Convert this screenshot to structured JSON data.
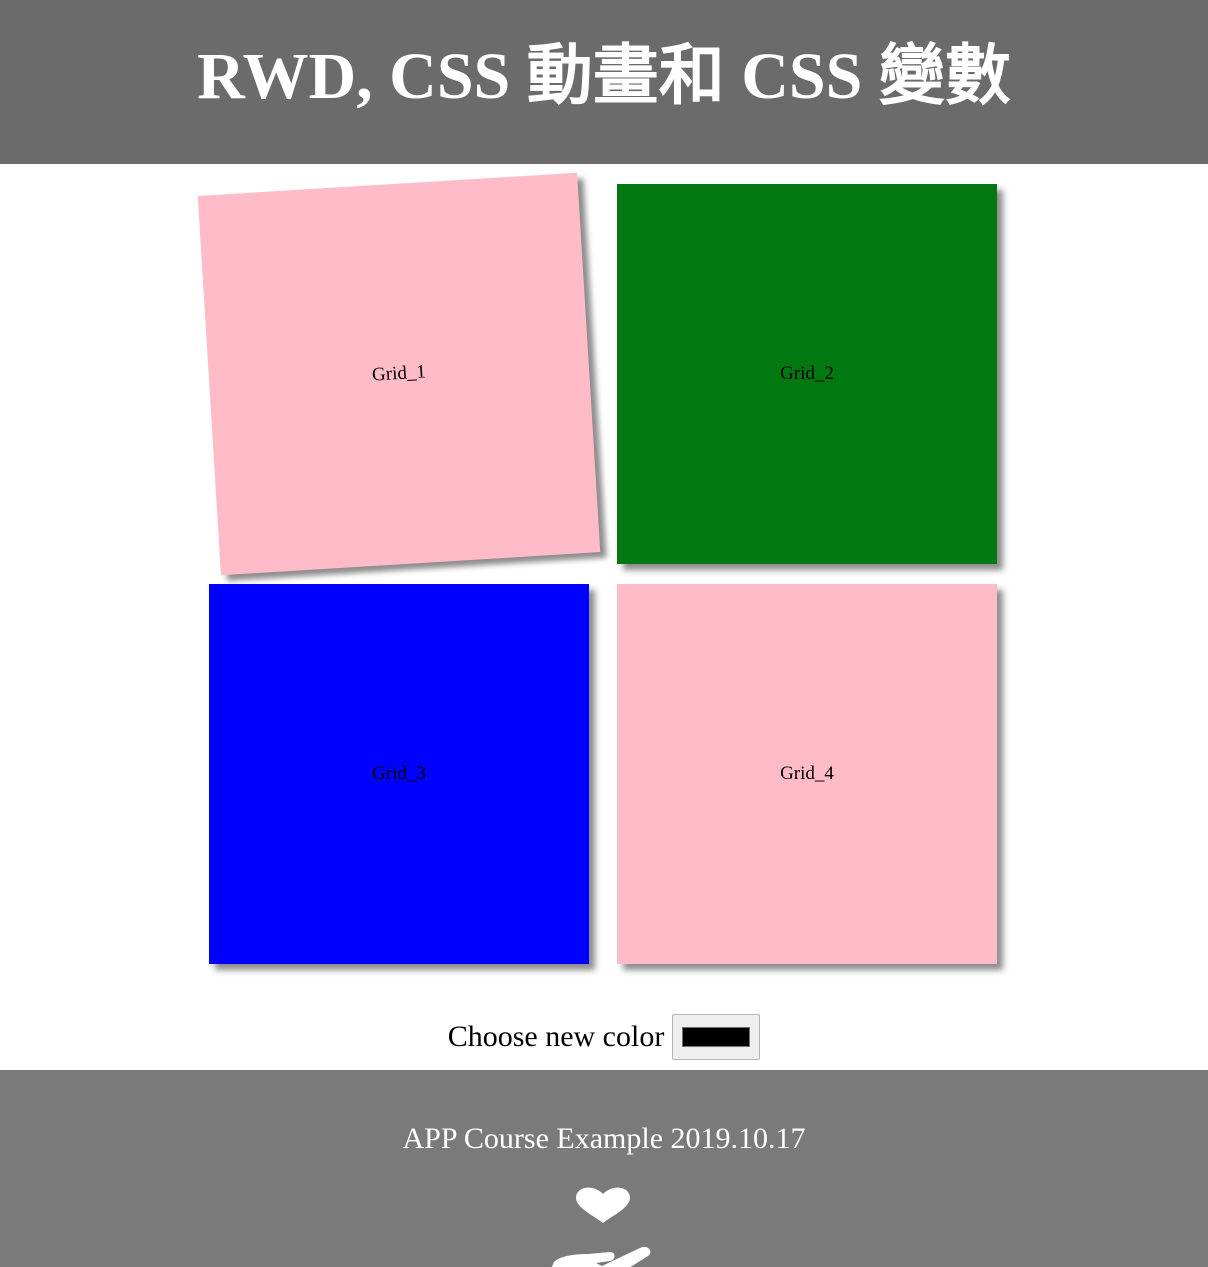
{
  "header": {
    "title": "RWD, CSS 動畫和 CSS 變數"
  },
  "grids": [
    {
      "label": "Grid_1",
      "color": "#ffbcc8"
    },
    {
      "label": "Grid_2",
      "color": "#037811"
    },
    {
      "label": "Grid_3",
      "color": "#0000ff"
    },
    {
      "label": "Grid_4",
      "color": "#ffbcc8"
    }
  ],
  "picker": {
    "label": "Choose new color",
    "value": "#000000"
  },
  "footer": {
    "text": "APP Course Example 2019.10.17",
    "icon": "hand-holding-heart-icon"
  },
  "colors": {
    "header_bg": "#6b6b6b",
    "footer_bg": "#7a7a7a"
  }
}
